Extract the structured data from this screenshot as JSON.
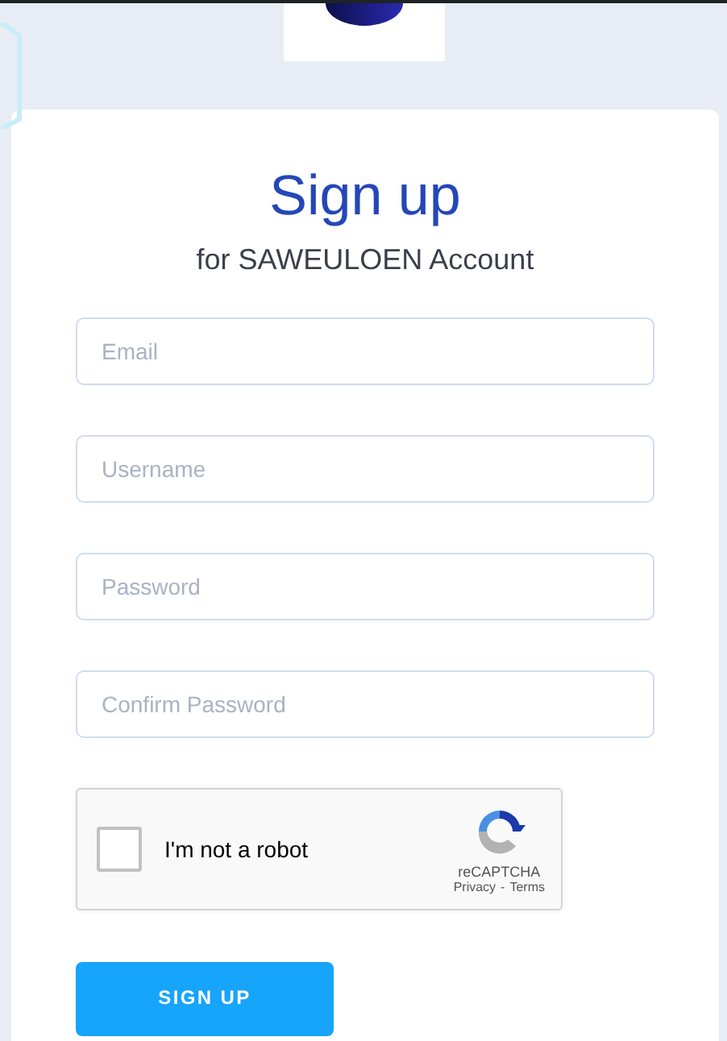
{
  "title": "Sign up",
  "subtitle": "for SAWEULOEN Account",
  "fields": [
    {
      "placeholder": "Email"
    },
    {
      "placeholder": "Username"
    },
    {
      "placeholder": "Password"
    },
    {
      "placeholder": "Confirm Password"
    }
  ],
  "captcha": {
    "label": "I'm not a robot",
    "checked": false,
    "brand": "reCAPTCHA",
    "privacy": "Privacy",
    "separator": "-",
    "terms": "Terms"
  },
  "submit": "SIGN UP"
}
